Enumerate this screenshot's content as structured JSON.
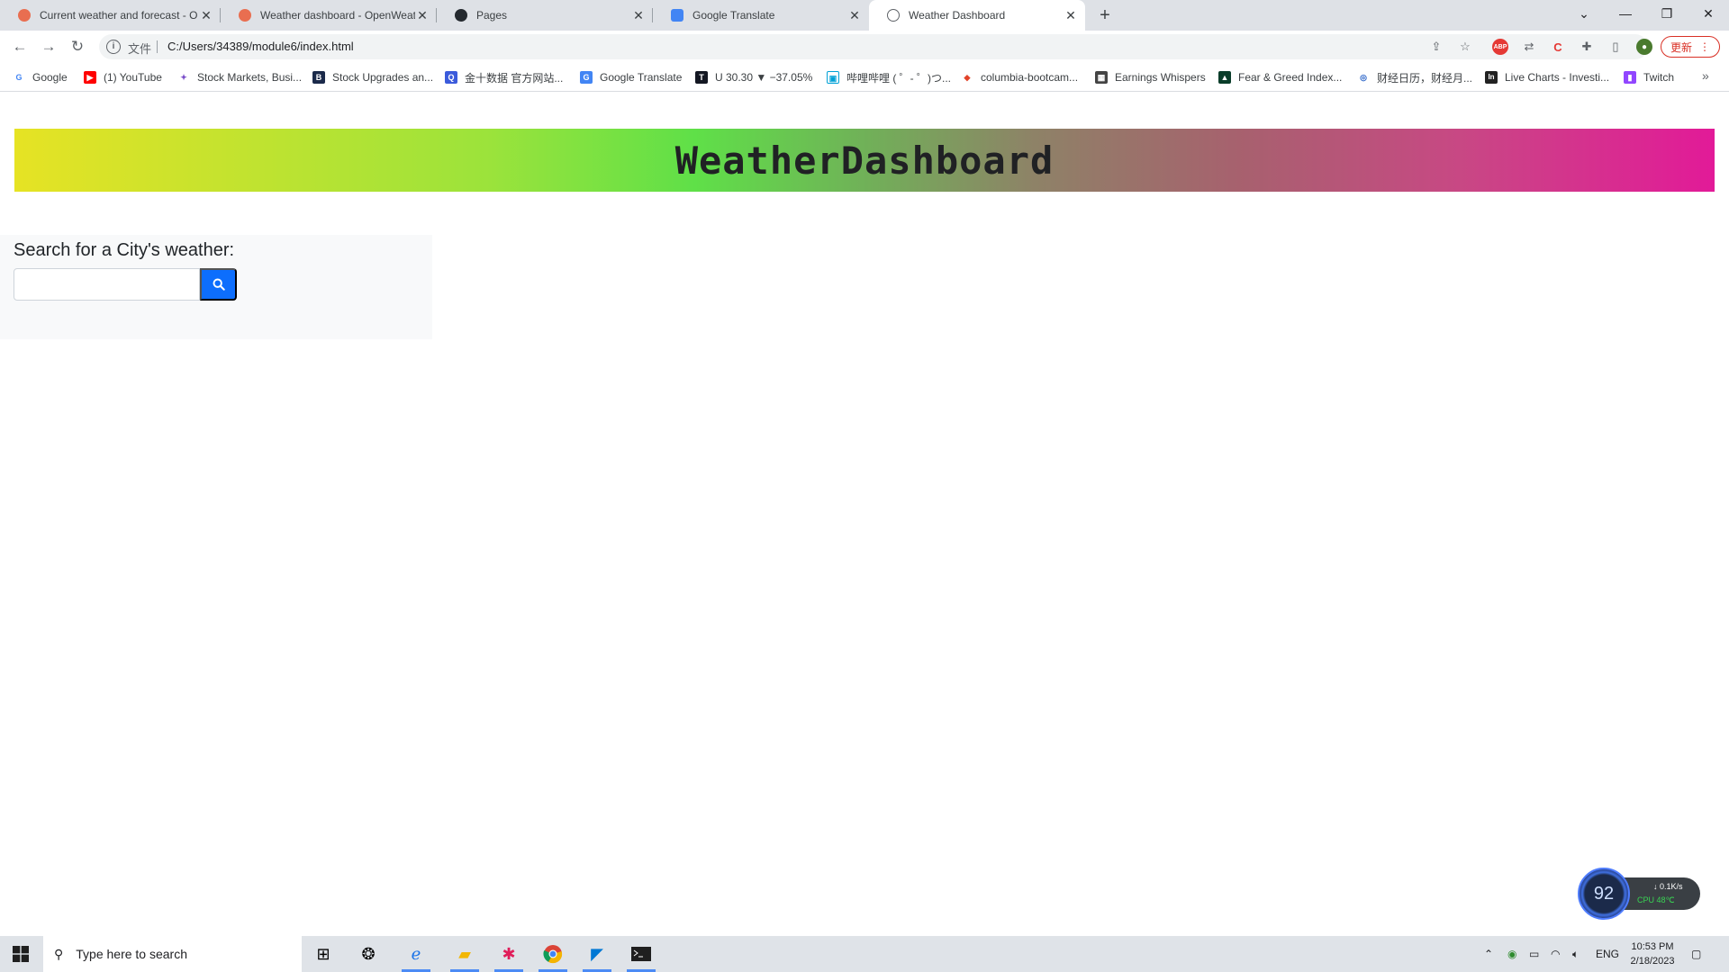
{
  "browser": {
    "tabs": [
      {
        "title": "Current weather and forecast - O",
        "favicon": "openweather-icon",
        "color": "#e96e50",
        "active": false
      },
      {
        "title": "Weather dashboard - OpenWeat",
        "favicon": "openweather-icon",
        "color": "#e96e50",
        "active": false
      },
      {
        "title": "Pages",
        "favicon": "github-icon",
        "color": "#24292f",
        "active": false
      },
      {
        "title": "Google Translate",
        "favicon": "translate-icon",
        "color": "#4285f4",
        "active": false
      },
      {
        "title": "Weather Dashboard",
        "favicon": "globe-icon",
        "color": "#5f6368",
        "active": true
      }
    ],
    "new_tab": "+",
    "address": {
      "scheme_label": "文件",
      "url": "C:/Users/34389/module6/index.html"
    },
    "update_label": "更新",
    "bookmarks": [
      {
        "label": "Google",
        "icon": "google-icon",
        "color": "#4285f4",
        "glyph": "G"
      },
      {
        "label": "(1) YouTube",
        "icon": "youtube-icon",
        "color": "#ff0000",
        "glyph": "▶"
      },
      {
        "label": "Stock Markets, Busi...",
        "icon": "cnbc-icon",
        "color": "#7b4fc9",
        "glyph": "✦"
      },
      {
        "label": "Stock Upgrades an...",
        "icon": "benzinga-icon",
        "color": "#1b2a4a",
        "glyph": "B"
      },
      {
        "label": "金十数据 官方网站...",
        "icon": "jin10-icon",
        "color": "#3b5bdb",
        "glyph": "Q"
      },
      {
        "label": "Google Translate",
        "icon": "translate-icon",
        "color": "#4285f4",
        "glyph": "G"
      },
      {
        "label": "U 30.30 ▼ −37.05%",
        "icon": "tradingview-icon",
        "color": "#131722",
        "glyph": "T"
      },
      {
        "label": "哔哩哔哩 ( ゜- ゜)つ...",
        "icon": "bilibili-icon",
        "color": "#00a1d6",
        "glyph": "▣"
      },
      {
        "label": "columbia-bootcam...",
        "icon": "gitlab-icon",
        "color": "#e24329",
        "glyph": "◆"
      },
      {
        "label": "Earnings Whispers",
        "icon": "earnings-icon",
        "color": "#444444",
        "glyph": "▦"
      },
      {
        "label": "Fear & Greed Index...",
        "icon": "cnn-icon",
        "color": "#0a3d2a",
        "glyph": "▲"
      },
      {
        "label": "财经日历，财经月...",
        "icon": "calendar-icon",
        "color": "#2a64c8",
        "glyph": "◎"
      },
      {
        "label": "Live Charts - Investi...",
        "icon": "investing-icon",
        "color": "#222222",
        "glyph": "In"
      },
      {
        "label": "Twitch",
        "icon": "twitch-icon",
        "color": "#9146ff",
        "glyph": "▮"
      }
    ],
    "bookmarks_more": "»"
  },
  "page": {
    "header_title": "WeatherDashboard",
    "search": {
      "label": "Search for a City's weather:",
      "input_value": "",
      "button_icon": "search-icon"
    }
  },
  "widget": {
    "score": "92",
    "net_speed": "↓ 0.1K/s",
    "cpu": "CPU 48℃"
  },
  "taskbar": {
    "search_placeholder": "Type here to search",
    "tray": {
      "language": "ENG",
      "time": "10:53 PM",
      "date": "2/18/2023"
    }
  }
}
